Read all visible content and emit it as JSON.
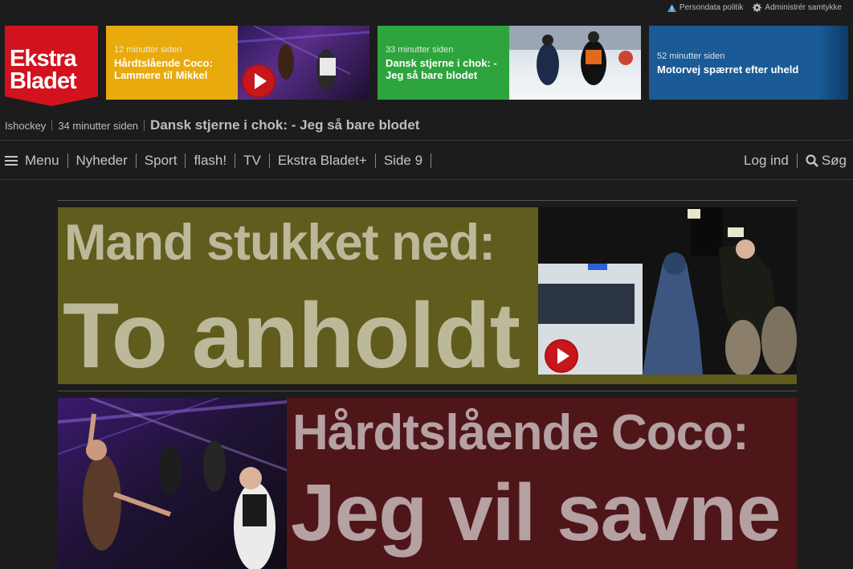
{
  "top_links": {
    "privacy": "Persondata politik",
    "consent": "Administrér samtykke"
  },
  "logo": {
    "line1": "Ekstra",
    "line2": "Bladet"
  },
  "teasers": [
    {
      "time": "12 minutter siden",
      "headline": "Hårdtslående Coco: Lammere til Mikkel",
      "color": "#e8aa0c",
      "has_video": true
    },
    {
      "time": "33 minutter siden",
      "headline": "Dansk stjerne i chok: - Jeg så bare blodet",
      "color": "#2ea43e",
      "has_video": false
    },
    {
      "time": "52 minutter siden",
      "headline": "Motorvej spærret efter uheld",
      "color": "#1a5a96",
      "has_video": false
    }
  ],
  "ticker": {
    "category": "Ishockey",
    "time": "34 minutter siden",
    "headline": "Dansk stjerne i chok: - Jeg så bare blodet"
  },
  "nav": {
    "menu_label": "Menu",
    "items": [
      "Nyheder",
      "Sport",
      "flash!",
      "TV",
      "Ekstra Bladet+",
      "Side 9"
    ],
    "login": "Log ind",
    "search": "Søg"
  },
  "stories": [
    {
      "kicker": "Mand stukket ned:",
      "headline": "To anholdt",
      "bg": "#5f5c1d",
      "has_video": true
    },
    {
      "kicker": "Hårdtslående Coco:",
      "headline": "Jeg vil savne",
      "bg": "#4e1619",
      "has_video": false
    }
  ]
}
